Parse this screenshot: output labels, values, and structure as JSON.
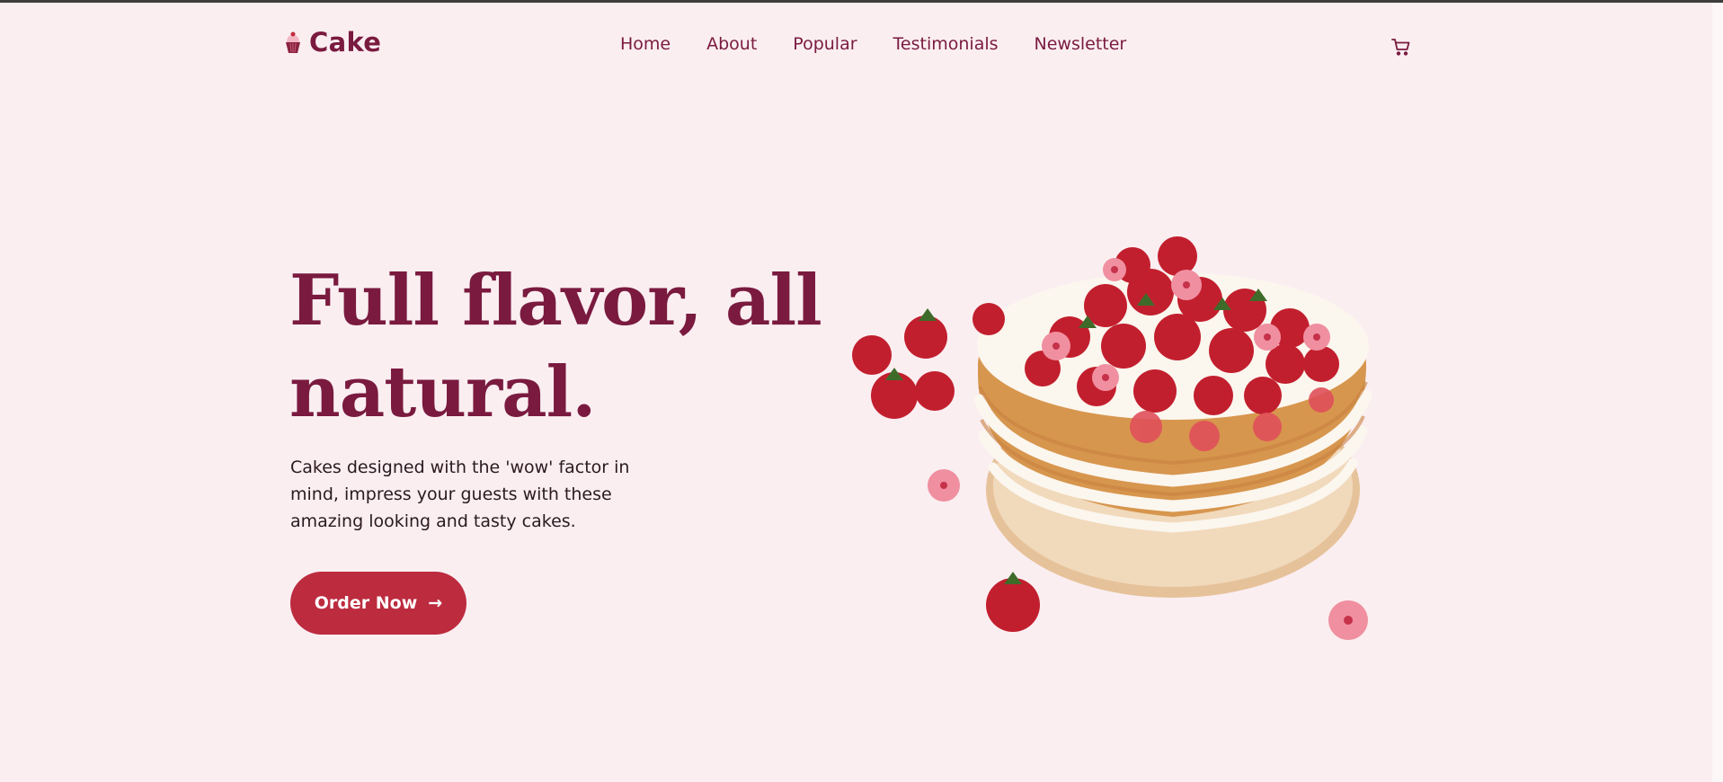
{
  "brand": {
    "name": "Cake",
    "logo_icon": "cupcake-icon"
  },
  "nav": {
    "items": [
      {
        "label": "Home"
      },
      {
        "label": "About"
      },
      {
        "label": "Popular"
      },
      {
        "label": "Testimonials"
      },
      {
        "label": "Newsletter"
      }
    ],
    "cart_icon": "cart-icon"
  },
  "hero": {
    "headline_line1": "Full flavor, all",
    "headline_line2": "natural.",
    "description_line1": "Cakes designed with the 'wow' factor in",
    "description_line2": "mind, impress your guests with these",
    "description_line3": "amazing looking and tasty cakes.",
    "cta_label": "Order Now",
    "cta_icon": "arrow-right-icon",
    "image": "strawberry-cake-illustration"
  },
  "colors": {
    "background": "#faeef1",
    "brand": "#7a1a3f",
    "cta": "#bd2b3f"
  }
}
